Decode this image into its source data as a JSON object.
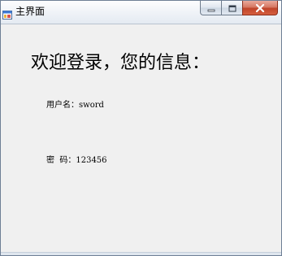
{
  "window": {
    "title": "主界面",
    "icon": "windows-form-icon"
  },
  "caption_buttons": {
    "minimize_icon": "minimize-icon",
    "maximize_icon": "maximize-icon",
    "close_icon": "close-icon"
  },
  "main": {
    "welcome_text": "欢迎登录，您的信息：",
    "username_label": "用户名：",
    "username_value": "sword",
    "password_label": "密  码：",
    "password_value": "123456"
  },
  "colors": {
    "close_button": "#c0442a",
    "window_background": "#f0f0f0"
  }
}
